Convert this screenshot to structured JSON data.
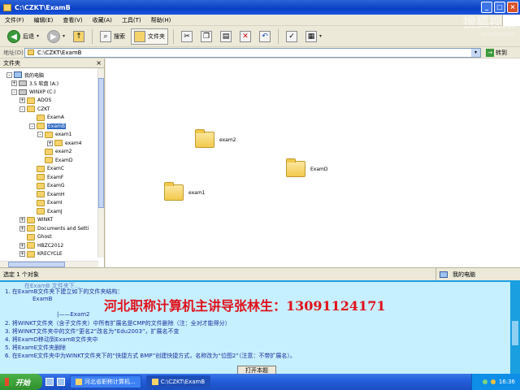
{
  "window": {
    "title": "C:\\CZKT\\ExamB",
    "min": "_",
    "max": "□",
    "close": "×"
  },
  "menu": [
    "文件(F)",
    "编辑(E)",
    "查看(V)",
    "收藏(A)",
    "工具(T)",
    "帮助(H)"
  ],
  "toolbar": {
    "back": "后退",
    "search": "搜索",
    "folders": "文件夹"
  },
  "address": {
    "label": "地址(D)",
    "value": "C:\\CZKT\\ExamB",
    "go": "转到"
  },
  "panel": {
    "title": "文件夹",
    "close": "×"
  },
  "tree": [
    {
      "label": "我的电脑",
      "exp": "-",
      "icon": "pc"
    },
    {
      "label": "3.5 软盘 (A:)",
      "exp": "+",
      "icon": "drv"
    },
    {
      "label": "WINXP (C:)",
      "exp": "-",
      "icon": "drv"
    },
    {
      "label": "ADOS",
      "exp": "+",
      "icon": "fld"
    },
    {
      "label": "CZKT",
      "exp": "-",
      "icon": "fld"
    },
    {
      "label": "ExamA",
      "exp": "",
      "icon": "fld"
    },
    {
      "label": "ExamB",
      "exp": "-",
      "icon": "fld",
      "selected": true
    },
    {
      "label": "exam1",
      "exp": "-",
      "icon": "fld"
    },
    {
      "label": "exam4",
      "exp": "+",
      "icon": "fld"
    },
    {
      "label": "exam2",
      "exp": "",
      "icon": "fld"
    },
    {
      "label": "ExamD",
      "exp": "",
      "icon": "fld"
    },
    {
      "label": "ExamC",
      "exp": "",
      "icon": "fld"
    },
    {
      "label": "ExamF",
      "exp": "",
      "icon": "fld"
    },
    {
      "label": "ExamG",
      "exp": "",
      "icon": "fld"
    },
    {
      "label": "ExamH",
      "exp": "",
      "icon": "fld"
    },
    {
      "label": "ExamI",
      "exp": "",
      "icon": "fld"
    },
    {
      "label": "ExamJ",
      "exp": "",
      "icon": "fld"
    },
    {
      "label": "WINKT",
      "exp": "+",
      "icon": "fld"
    },
    {
      "label": "Documents and Setti",
      "exp": "+",
      "icon": "fld"
    },
    {
      "label": "Ghost",
      "exp": "",
      "icon": "fld"
    },
    {
      "label": "HBZC2012",
      "exp": "+",
      "icon": "fld"
    },
    {
      "label": "KRECYCLE",
      "exp": "+",
      "icon": "fld"
    }
  ],
  "files": [
    {
      "label": "exam2"
    },
    {
      "label": "ExamD"
    },
    {
      "label": "exam1"
    }
  ],
  "status": {
    "count": "选定 1 个对象",
    "location": "我的电脑"
  },
  "doc": {
    "line0": "在ExamB 文件夹下...",
    "line1": "1.   在ExamB文件夹下建立如下的文件夹结构：",
    "line1b": "ExamB",
    "line1c": "|——Exam2",
    "line2": "2.   将WINKT文件夹（含子文件夹）中所有扩展名是CMP的文件删除（注：全对才能得分）",
    "line3": "3.   将WINKT文件夹中的文件“更名2”改名为“Edu2003”，扩展名不变",
    "line4": "4.   将ExamD移动到ExamB文件夹中",
    "line5": "5.   将ExamE文件夹删除",
    "line6": "6.   在ExamE文件夹中为WINKT文件夹下的“快捷方式 BMP”创建快捷方式，名称改为“位图2”（注意：不带扩展名）。",
    "overlay": "河北职称计算机主讲导张林生：13091124171",
    "open_button": "打开本题"
  },
  "watermark": {
    "brand": "搜狐视频",
    "url": "tv.sohu.com"
  },
  "taskbar": {
    "start": "开始",
    "tasks": [
      "河北省职称计算机...",
      "C:\\CZKT\\ExamB"
    ],
    "clock": "16:36"
  }
}
